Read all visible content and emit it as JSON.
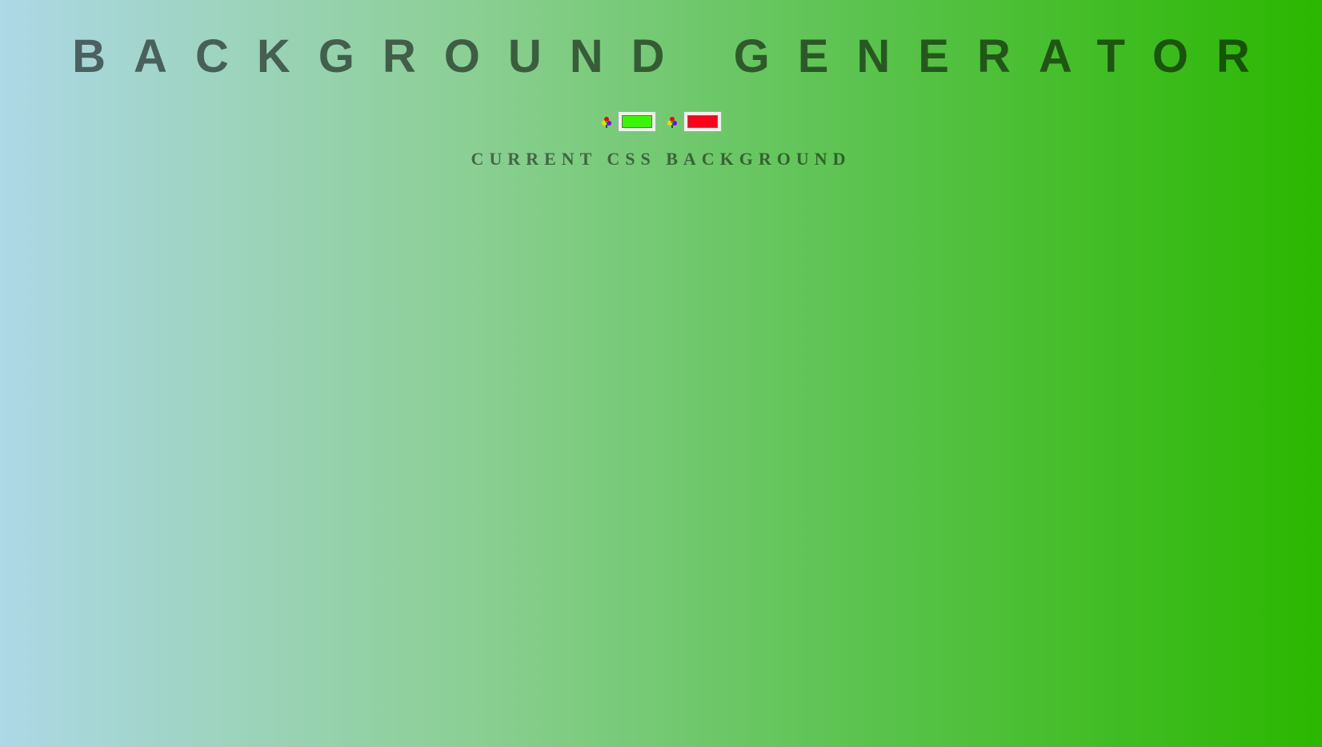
{
  "title": "BACKGROUND GENERATOR",
  "subtitle": "CURRENT CSS BACKGROUND",
  "color_pickers": [
    {
      "icon": "color-palette-icon",
      "value": "#39f700"
    },
    {
      "icon": "color-palette-icon",
      "value": "#ff0018"
    }
  ],
  "background": {
    "type": "linear-gradient",
    "direction": "to right",
    "start_color": "#add8e6",
    "end_color": "#2bb700"
  }
}
